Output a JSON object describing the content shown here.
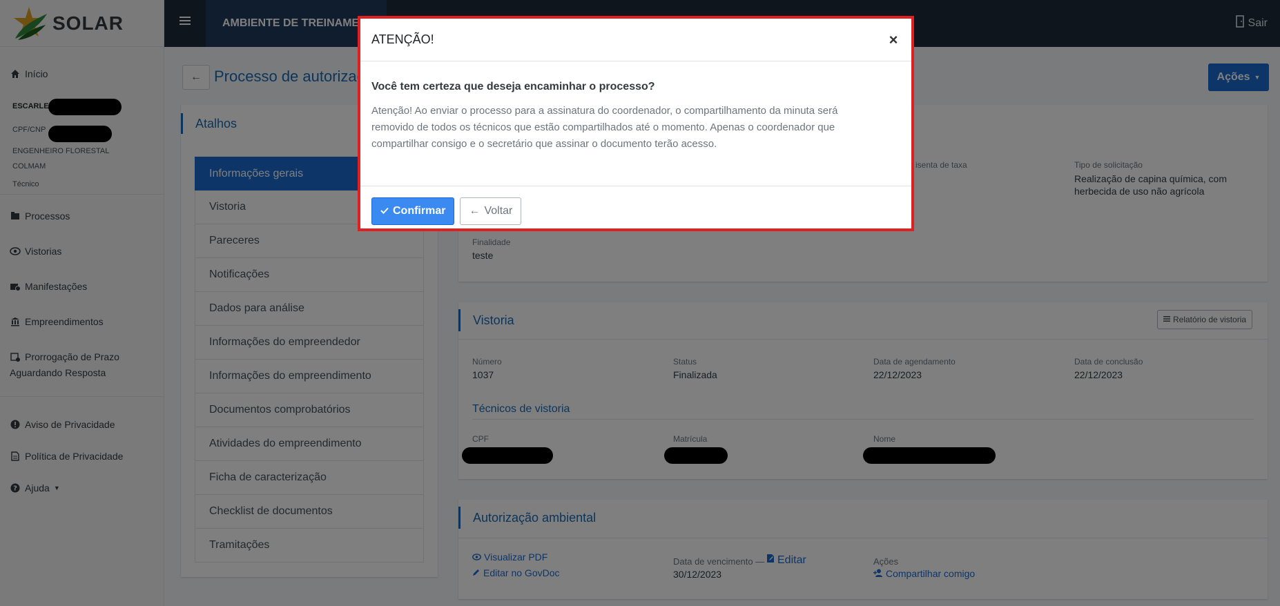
{
  "brand": {
    "name": "SOLAR"
  },
  "sidebar": {
    "inicio": "Início",
    "user_name": "ESCARLE",
    "user_doc": "CPF/CNP",
    "user_role1": "ENGENHEIRO FLORESTAL",
    "user_role2": "COLMAM",
    "user_type": "Técnico",
    "processos": "Processos",
    "vistorias": "Vistorias",
    "manifestacoes": "Manifestações",
    "empreendimentos": "Empreendimentos",
    "prorrogacao1": "Prorrogação de Prazo",
    "prorrogacao2": "Aguardando Resposta",
    "aviso": "Aviso de Privacidade",
    "politica": "Política de Privacidade",
    "ajuda": "Ajuda"
  },
  "topbar": {
    "env": "AMBIENTE DE TREINAMENTO",
    "sair": "Sair"
  },
  "header": {
    "title": "Processo de autorização",
    "acoes": "Ações"
  },
  "shortcuts": {
    "title": "Atalhos",
    "items": [
      "Informações gerais",
      "Vistoria",
      "Pareceres",
      "Notificações",
      "Dados para análise",
      "Informações do empreendedor",
      "Informações do empreendimento",
      "Documentos comprobatórios",
      "Atividades do empreendimento",
      "Ficha de caracterização",
      "Checklist de documentos",
      "Tramitações"
    ]
  },
  "general": {
    "isenta_label": "o isenta de taxa",
    "tipo_label": "Tipo de solicitação",
    "tipo_value": "Realização de capina química, com herbecida de uso não agrícola",
    "finalidade_label": "Finalidade",
    "finalidade_value": "teste"
  },
  "vistoria": {
    "title": "Vistoria",
    "report_btn": "Relatório de vistoria",
    "numero_label": "Número",
    "numero_value": "1037",
    "status_label": "Status",
    "status_value": "Finalizada",
    "agendamento_label": "Data de agendamento",
    "agendamento_value": "22/12/2023",
    "conclusao_label": "Data de conclusão",
    "conclusao_value": "22/12/2023",
    "tecnicos_title": "Técnicos de vistoria",
    "cpf_label": "CPF",
    "matricula_label": "Matrícula",
    "nome_label": "Nome"
  },
  "autorizacao": {
    "title": "Autorização ambiental",
    "visualizar": "Visualizar PDF",
    "editar_govdoc": "Editar no GovDoc",
    "vencimento_label": "Data de vencimento —",
    "editar": "Editar",
    "vencimento_value": "30/12/2023",
    "acoes_label": "Ações",
    "compartilhar": "Compartilhar comigo"
  },
  "modal": {
    "title": "ATENÇÃO!",
    "close": "×",
    "question": "Você tem certeza que deseja encaminhar o processo?",
    "text": "Atenção! Ao enviar o processo para a assinatura do coordenador, o compartilhamento da minuta será removido de todos os técnicos que estão compartilhados até o momento. Apenas o coordenador que compartilhar consigo e o secretário que assinar o documento terão acesso.",
    "confirm": "Confirmar",
    "back": "Voltar"
  }
}
